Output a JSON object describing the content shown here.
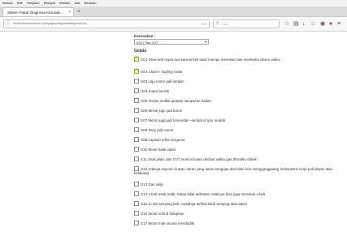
{
  "menubar": [
    "Berkas",
    "Edit",
    "Tampilan",
    "Riwayat",
    "Markah",
    "Alat",
    "Bantuan"
  ],
  "tab": {
    "title": "Sistem Pakar Diagnosa Kerusak...",
    "close": "×"
  },
  "newtab": "+",
  "urlbar": {
    "url": "localhost/sistem/index.php/pages/diagnosa/diagnosa.php",
    "actions": "▾ C"
  },
  "search": {
    "placeholder": "Cari"
  },
  "kerusakan": {
    "label": "Kerusakan :",
    "selected": "K01 | Pan CVT"
  },
  "gejala_title": "Gejala",
  "gejala": [
    {
      "text": "G01   Drive belt cepat aus karena belt tidak mampu menekan dan membuka driven pulley",
      "checked": true
    },
    {
      "text": "G02   Clutch / kopling rusak",
      "checked": true
    },
    {
      "text": "G03   Laju motor jadi lambat",
      "checked": false
    },
    {
      "text": "G04   Suara berisik",
      "checked": false
    },
    {
      "text": "G05   Terasa sedikit getaran sampai ke badan",
      "checked": false
    },
    {
      "text": "G06   Mesin jugo jadi boros",
      "checked": false
    },
    {
      "text": "G07   Mesin juga jadi tersendat—sendat di rpm rendah",
      "checked": false
    },
    {
      "text": "G08   Drep jadi macet",
      "checked": false
    },
    {
      "text": "G09   Lapisan teflon tergerus",
      "checked": false
    },
    {
      "text": "G10   Motor tidak stabil",
      "checked": false
    },
    {
      "text": "G11   Saat jalan, dari CVT muncul suara decitan waktu gas (throttle) ditarik",
      "checked": false
    },
    {
      "text": "G12   Adanya sejenis oli atau cairan yang lama menguap dan bikin licin menggangguang mekanisme kerja puli depan atau belakang",
      "checked": false
    },
    {
      "text": "G13   Gas selip",
      "checked": false
    },
    {
      "text": "G14   v-belt retak-retak. Kalau tidak kelihatan retaknya bisa juga menekuk v-belt",
      "checked": false
    },
    {
      "text": "G15   Si sisi samping belt, suduthya terlihat lebih ramping atau tajam",
      "checked": false
    },
    {
      "text": "G16   Motor sulit di hidupkan",
      "checked": false
    },
    {
      "text": "G17   Motor mati secara mendadak",
      "checked": false
    }
  ]
}
